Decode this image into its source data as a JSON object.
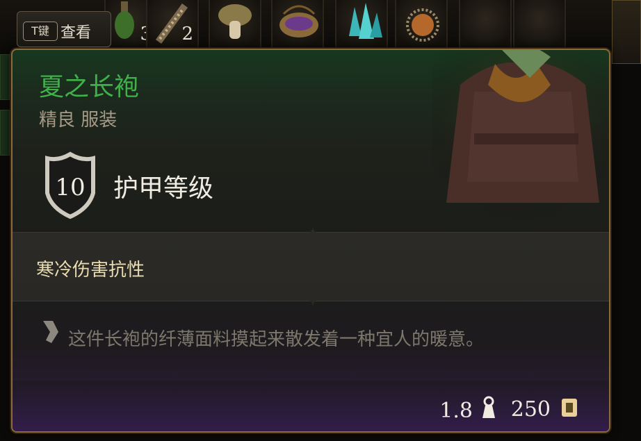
{
  "hotkey": {
    "key": "T键",
    "label": "查看"
  },
  "inventory": {
    "slots": [
      {
        "icon": "potion-icon",
        "count": "3"
      },
      {
        "icon": "scroll-icon",
        "count": "2"
      },
      {
        "icon": "mushroom-icon",
        "count": ""
      },
      {
        "icon": "bowl-icon",
        "count": ""
      },
      {
        "icon": "crystal-icon",
        "count": ""
      },
      {
        "icon": "spiky-seed-icon",
        "count": ""
      }
    ]
  },
  "item": {
    "name": "夏之长袍",
    "subtitle": "精良 服装",
    "armor_class": "10",
    "armor_label": "护甲等级",
    "property": "寒冷伤害抗性",
    "description": "这件长袍的纤薄面料摸起来散发着一种宜人的暖意。",
    "weight": "1.8",
    "value": "250",
    "portrait_icon": "robe-icon"
  },
  "colors": {
    "name_green": "#3fb14b",
    "border_gold": "#8c6a3a",
    "property_text": "#e8dcb0"
  }
}
